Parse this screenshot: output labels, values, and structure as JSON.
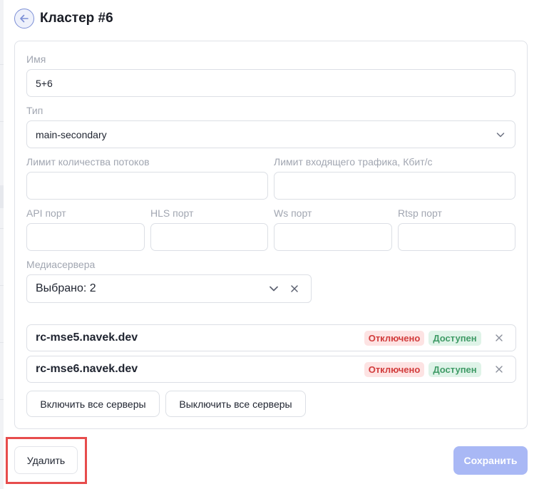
{
  "header": {
    "title": "Кластер #6",
    "back_icon": "arrow-left-icon"
  },
  "form": {
    "name": {
      "label": "Имя",
      "value": "5+6"
    },
    "type": {
      "label": "Тип",
      "value": "main-secondary"
    },
    "streams_limit": {
      "label": "Лимит количества потоков",
      "value": ""
    },
    "traffic_limit": {
      "label": "Лимит входящего трафика, Кбит/с",
      "value": ""
    },
    "api_port": {
      "label": "API порт",
      "value": ""
    },
    "hls_port": {
      "label": "HLS порт",
      "value": ""
    },
    "ws_port": {
      "label": "Ws порт",
      "value": ""
    },
    "rtsp_port": {
      "label": "Rtsp порт",
      "value": ""
    },
    "mediaservers": {
      "label": "Медиасервера",
      "value": "Выбрано: 2"
    }
  },
  "servers": [
    {
      "name": "rc-mse5.navek.dev",
      "status_disabled": "Отключено",
      "status_available": "Доступен"
    },
    {
      "name": "rc-mse6.navek.dev",
      "status_disabled": "Отключено",
      "status_available": "Доступен"
    }
  ],
  "actions": {
    "enable_all": "Включить все серверы",
    "disable_all": "Выключить все серверы",
    "delete": "Удалить",
    "save": "Сохранить"
  },
  "colors": {
    "accent": "#a9b8f5",
    "danger_outline": "#e74c4c",
    "badge_off_bg": "#fde3e3",
    "badge_off_text": "#d23c3c",
    "badge_on_bg": "#dff3e8",
    "badge_on_text": "#3f9b66"
  }
}
